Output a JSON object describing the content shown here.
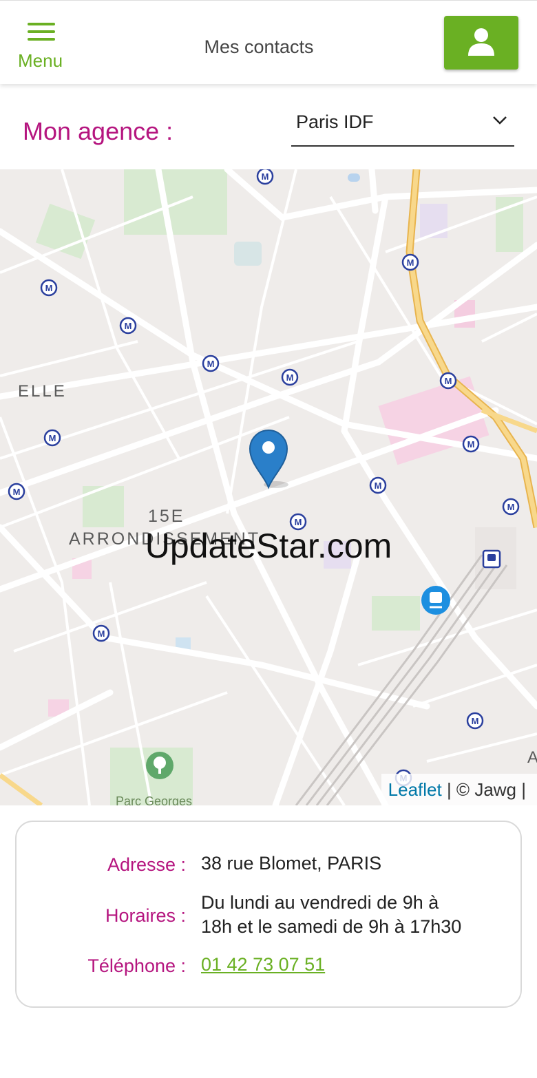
{
  "header": {
    "menu_label": "Menu",
    "title": "Mes contacts",
    "icons": {
      "menu": "hamburger-icon",
      "user": "user-icon"
    }
  },
  "agency": {
    "label": "Mon agence :",
    "selected": "Paris IDF"
  },
  "map": {
    "labels": {
      "district_number": "15E",
      "district_name": "ARRONDISSEMENT",
      "left_partial": "ELLE",
      "right_partial": "A",
      "park_partial": "Parc Georges"
    },
    "watermark": "UpdateStar.com",
    "attribution_link": "Leaflet",
    "attribution_rest": " | © Jawg |",
    "metro_badge": "M"
  },
  "contact": {
    "address_label": "Adresse :",
    "address_value": "38 rue Blomet, PARIS",
    "hours_label": "Horaires :",
    "hours_line1": "Du lundi au vendredi de 9h à",
    "hours_line2": "18h et le samedi de 9h à 17h30",
    "phone_label": "Téléphone :",
    "phone_value": "01 42 73 07 51"
  },
  "colors": {
    "brand_green": "#6ab023",
    "brand_magenta": "#b5157f",
    "map_bg": "#efecea",
    "pin_blue": "#2a7fc9",
    "highway": "#f4c56b"
  }
}
